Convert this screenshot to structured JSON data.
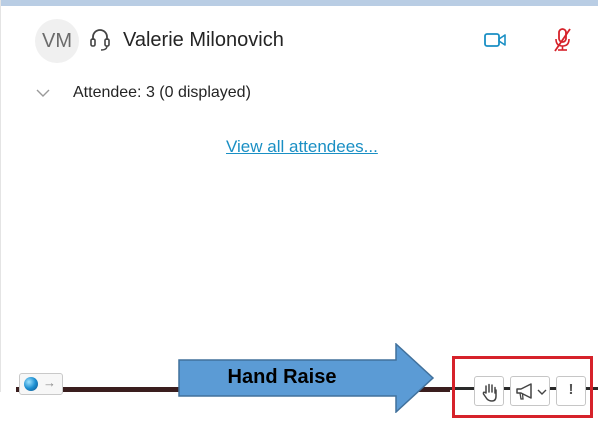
{
  "participant": {
    "initials": "VM",
    "name": "Valerie Milonovich",
    "audio_icon": "headset-icon",
    "video_icon": "video-camera-icon",
    "mic_icon": "microphone-muted-icon"
  },
  "attendees": {
    "summary": "Attendee: 3 (0 displayed)",
    "view_all_link": "View all attendees...",
    "expand_icon": "chevron-down-icon"
  },
  "callout": {
    "label": "Hand Raise",
    "fill_color": "#5b9bd5",
    "stroke_color": "#41719c"
  },
  "toolbar": {
    "hand_raise_icon": "raised-hand-icon",
    "announce_icon": "megaphone-icon",
    "announce_dropdown_icon": "chevron-down-icon",
    "alert_label": "!"
  },
  "status": {
    "icon": "globe-status-icon",
    "arrow": "→"
  },
  "colors": {
    "accent": "#1a8fc4",
    "muted_red": "#d6222a",
    "highlight_border": "#d6222a"
  }
}
